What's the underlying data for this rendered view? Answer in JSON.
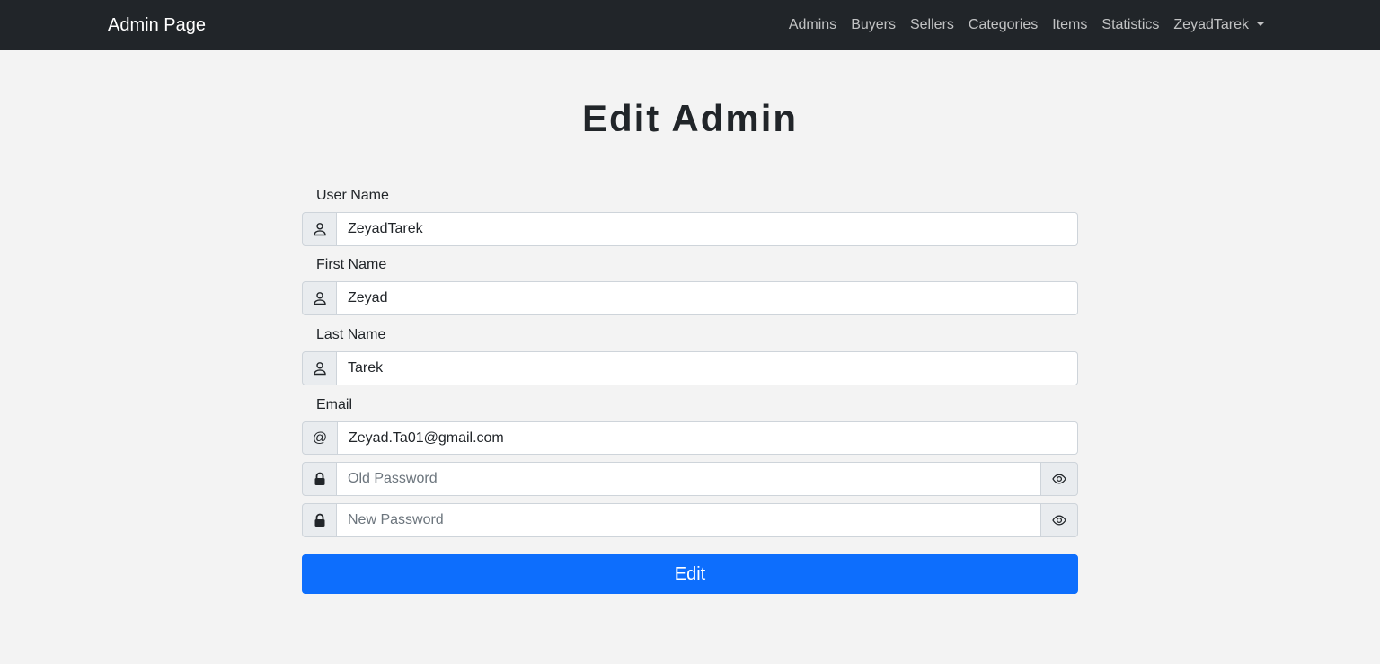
{
  "navbar": {
    "brand": "Admin Page",
    "links": [
      "Admins",
      "Buyers",
      "Sellers",
      "Categories",
      "Items",
      "Statistics"
    ],
    "user": "ZeyadTarek"
  },
  "page": {
    "title": "Edit Admin"
  },
  "form": {
    "username": {
      "label": "User Name",
      "value": "ZeyadTarek",
      "icon": "person-icon"
    },
    "first_name": {
      "label": "First Name",
      "value": "Zeyad",
      "icon": "person-icon"
    },
    "last_name": {
      "label": "Last Name",
      "value": "Tarek",
      "icon": "person-icon"
    },
    "email": {
      "label": "Email",
      "value": "Zeyad.Ta01@gmail.com",
      "addon": "@"
    },
    "old_password": {
      "placeholder": "Old Password",
      "icon": "lock-icon",
      "toggle_icon": "eye-icon"
    },
    "new_password": {
      "placeholder": "New Password",
      "icon": "lock-icon",
      "toggle_icon": "eye-icon"
    },
    "submit_label": "Edit"
  },
  "colors": {
    "navbar": "#212529",
    "primary": "#0d6efd",
    "background": "#f3f3f3"
  }
}
